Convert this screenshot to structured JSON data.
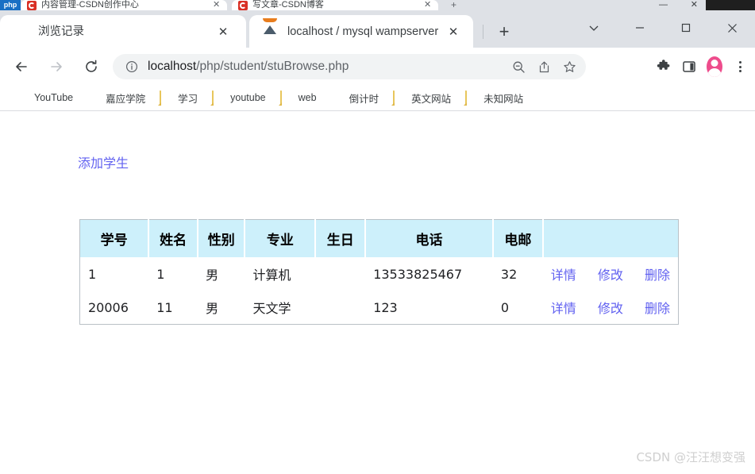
{
  "background_window": {
    "left_badge": "php",
    "tabs": [
      {
        "title": "内容管理-CSDN创作中心",
        "close": "✕"
      },
      {
        "title": "写文章-CSDN博客",
        "close": "✕"
      }
    ],
    "new_tab": "+",
    "minimize": "—",
    "close": "✕"
  },
  "browser": {
    "tabs": [
      {
        "title": "浏览记录",
        "icon": "wamp-w-icon",
        "close": "✕",
        "active": true
      },
      {
        "title": "localhost / mysql wampserver",
        "icon": "phpmyadmin-icon",
        "close": "✕",
        "active": false
      }
    ],
    "new_tab_label": "+",
    "window_controls": {
      "tab_search": "chevron-down-icon",
      "minimize": "minimize-icon",
      "maximize": "maximize-icon",
      "close": "close-icon"
    },
    "toolbar": {
      "back": "back-arrow-icon",
      "forward": "forward-arrow-icon",
      "reload": "reload-icon",
      "site_info": "info-circle-icon",
      "url_prefix": "localhost",
      "url_rest": "/php/student/stuBrowse.php",
      "url_full": "localhost/php/student/stuBrowse.php",
      "zoom_out": "zoom-out-icon",
      "share": "share-icon",
      "bookmark": "star-icon",
      "extensions": "puzzle-icon",
      "side_panel": "side-panel-icon",
      "profile": "avatar-icon",
      "menu": "three-dot-menu-icon"
    },
    "bookmarks": [
      {
        "label": "YouTube",
        "icon": "youtube-icon"
      },
      {
        "label": "嘉应学院",
        "icon": "blue-circle-icon"
      },
      {
        "label": "学习",
        "icon": "folder-icon"
      },
      {
        "label": "youtube",
        "icon": "folder-icon"
      },
      {
        "label": "web",
        "icon": "folder-icon"
      },
      {
        "label": "倒计时",
        "icon": "wamp-w-icon"
      },
      {
        "label": "英文网站",
        "icon": "folder-icon"
      },
      {
        "label": "未知网站",
        "icon": "folder-icon"
      }
    ]
  },
  "page": {
    "add_student_link": "添加学生",
    "table": {
      "headers": [
        "学号",
        "姓名",
        "性别",
        "专业",
        "生日",
        "电话",
        "电邮",
        ""
      ],
      "rows": [
        {
          "id": "1",
          "name": "1",
          "sex": "男",
          "major": "计算机",
          "birthday": "",
          "phone": "13533825467",
          "email": "32",
          "actions": [
            "详情",
            "修改",
            "删除"
          ]
        },
        {
          "id": "20006",
          "name": "11",
          "sex": "男",
          "major": "天文学",
          "birthday": "",
          "phone": "123",
          "email": "0",
          "actions": [
            "详情",
            "修改",
            "删除"
          ]
        }
      ]
    },
    "watermark": "CSDN @汪汪想变强"
  },
  "colors": {
    "link": "#6161f0",
    "table_header_bg": "#cdf0fb",
    "accent_pink": "#ec008c"
  }
}
